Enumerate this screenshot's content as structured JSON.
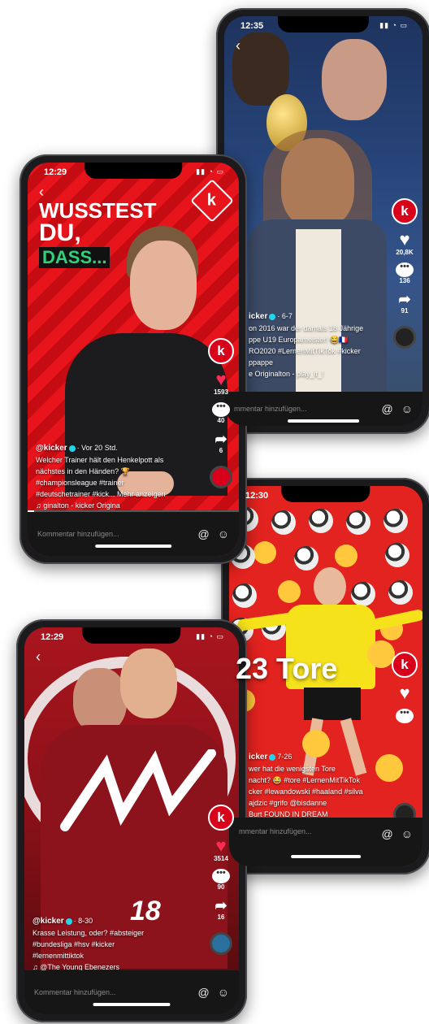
{
  "phones": {
    "p1": {
      "time": "12:35",
      "logo": "k",
      "likes": "20,8K",
      "comments": "136",
      "shares": "91",
      "username": "icker",
      "date": "· 6-7",
      "caption_lines": [
        "on 2016 war der damals 18 Jährige",
        "ppe U19 Europameister! 😂🇫🇷",
        "RO2020 #LernenMitTikTok #kicker",
        "ppappe"
      ],
      "music": "e   Originalton - play_it_!",
      "comment_placeholder": "mmentar hinzufügen..."
    },
    "p2": {
      "time": "12:29",
      "logo": "k",
      "headline_line1": "WUSSTEST",
      "headline_line2": "DU,",
      "headline_line3": "DASS...",
      "likes": "1593",
      "comments": "40",
      "shares": "6",
      "username": "@kicker",
      "date": "· Vor 20 Std.",
      "caption_lines": [
        "Welcher Trainer hält den Henkelpott als",
        "nächstes in den Händen? 🏆",
        "#championsleague #trainer",
        "#deutschetrainer #kick... Mehr anzeigen"
      ],
      "music": "ginalton - kicker    Origina",
      "comment_placeholder": "Kommentar hinzufügen..."
    },
    "p3": {
      "time": "12:30",
      "logo": "k",
      "overlay_text": "23 Tore",
      "username": "icker",
      "date": "7-26",
      "caption_lines": [
        "wer hat die wenigsten Tore",
        "nacht? 😂 #tore #LernenMitTikTok",
        "cker #lewandowski #haaland #silva",
        "ajdzic #grifo @bisdanne"
      ],
      "music": "Burt   FOUND IN DREAM",
      "comment_placeholder": "mmentar hinzufügen..."
    },
    "p4": {
      "time": "12:29",
      "logo": "k",
      "likes": "3514",
      "comments": "90",
      "shares": "16",
      "username": "@kicker",
      "date": "· 8-30",
      "caption_lines": [
        "Krasse Leistung, oder? #absteiger",
        "#bundesliga #hsv #kicker",
        "#lernenmittiktok"
      ],
      "music": "@The Young Ebenezers",
      "comment_placeholder": "Kommentar hinzufügen..."
    }
  },
  "icons": {
    "back": "chevron-left-icon",
    "like": "heart-icon",
    "comment": "comment-bubble-icon",
    "share": "share-arrow-icon",
    "music": "music-note-icon",
    "mention": "at-sign-icon",
    "emoji": "smiley-icon"
  },
  "colors": {
    "brand_red": "#d8001a",
    "like_red": "#fe2c55",
    "headline_green": "#1aa35b"
  }
}
